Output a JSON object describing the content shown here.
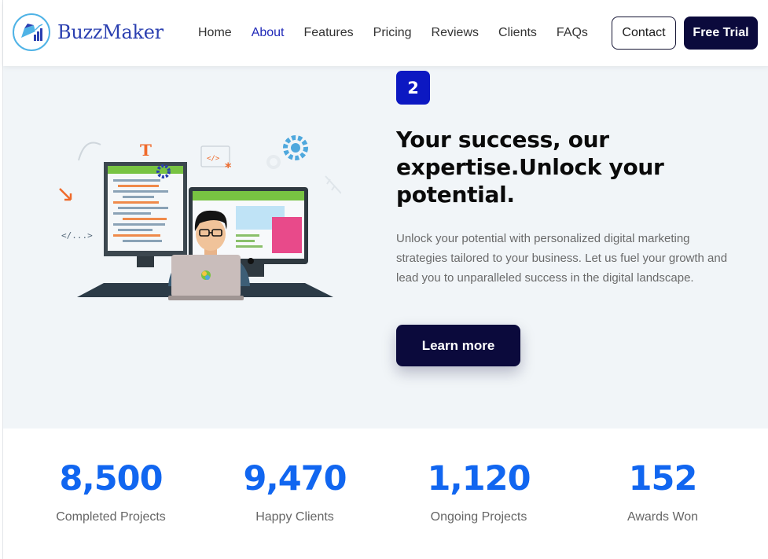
{
  "brand": {
    "name": "BuzzMaker"
  },
  "nav": {
    "items": [
      "Home",
      "About",
      "Features",
      "Pricing",
      "Reviews",
      "Clients",
      "FAQs"
    ],
    "active": "About",
    "contact_label": "Contact",
    "trial_label": "Free Trial"
  },
  "hero": {
    "step": "2",
    "title": "Your success, our expertise.Unlock your potential.",
    "description": "Unlock your potential with personalized digital marketing strategies tailored to your business. Let us fuel your growth and lead you to unparalleled success in the digital landscape.",
    "cta_label": "Learn more",
    "illustration": {
      "code_tag": "</...>",
      "snippet": "</>",
      "letter": "T"
    }
  },
  "stats": [
    {
      "value": "8,500",
      "label": "Completed Projects"
    },
    {
      "value": "9,470",
      "label": "Happy Clients"
    },
    {
      "value": "1,120",
      "label": "Ongoing Projects"
    },
    {
      "value": "152",
      "label": "Awards Won"
    }
  ],
  "colors": {
    "primary_dark": "#0b0a3c",
    "accent_blue": "#1166f0",
    "badge_blue": "#0c18c2",
    "active_link": "#2029b8"
  }
}
